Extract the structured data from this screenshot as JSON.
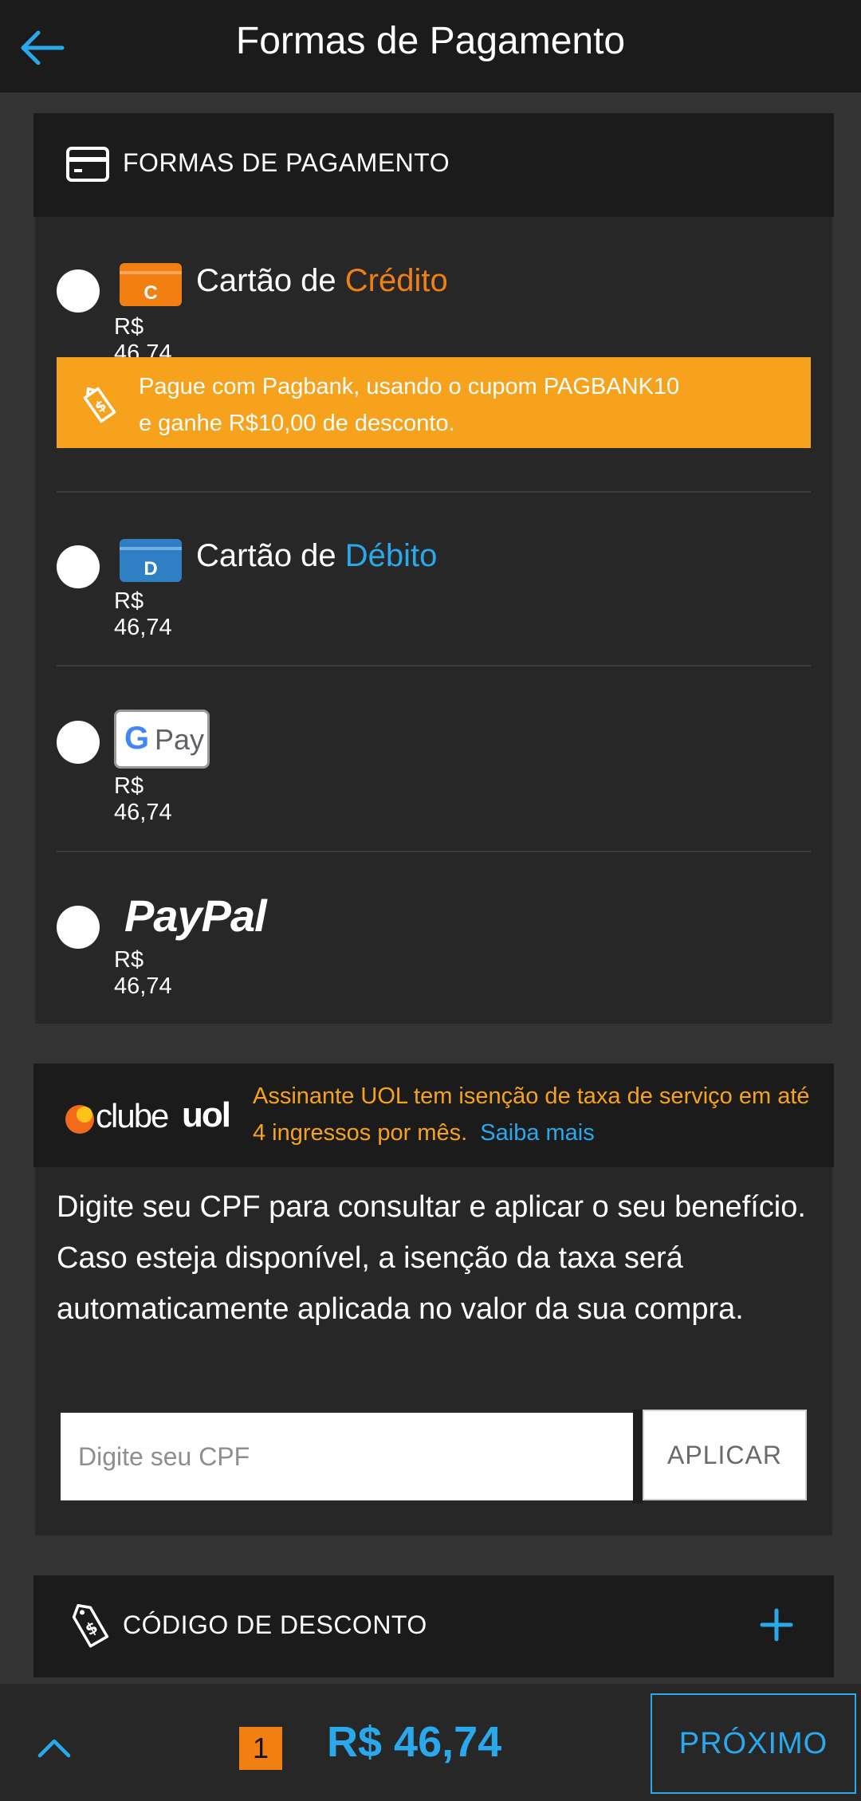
{
  "header": {
    "title": "Formas de Pagamento",
    "back_icon": "arrow-left-icon"
  },
  "payment": {
    "section_label": "FORMAS DE PAGAMENTO",
    "section_icon": "credit-card-icon",
    "methods": [
      {
        "id": "credit",
        "label_prefix": "Cartão de ",
        "label_highlight": "Crédito",
        "highlight_color": "#f17f12",
        "icon_letter": "C",
        "price": "R$ 46,74"
      },
      {
        "id": "debit",
        "label_prefix": "Cartão de ",
        "label_highlight": "Débito",
        "highlight_color": "#2aa8ec",
        "icon_letter": "D",
        "price": "R$ 46,74"
      },
      {
        "id": "gpay",
        "logo_g": "G",
        "logo_pay": "Pay",
        "price": "R$ 46,74"
      },
      {
        "id": "paypal",
        "logo": "PayPal",
        "price": "R$ 46,74"
      }
    ],
    "promo": {
      "line1": "Pague com Pagbank, usando o cupom PAGBANK10",
      "line2": "e ganhe R$10,00 de desconto.",
      "bg_color": "#f7a21c"
    }
  },
  "clube_uol": {
    "logo_text_a": "clube",
    "logo_text_b": "uol",
    "notice": "Assinante UOL tem isenção de taxa de serviço em até 4 ingressos por mês.",
    "link": "Saiba mais",
    "description": "Digite seu CPF para consultar e aplicar o seu benefício. Caso esteja disponível, a isenção da taxa será automaticamente aplicada no valor da sua compra.",
    "cpf_placeholder": "Digite seu CPF",
    "cpf_value": "",
    "apply_label": "APLICAR"
  },
  "discount": {
    "label": "CÓDIGO DE DESCONTO",
    "icon": "price-tag-icon",
    "expand_icon": "plus-icon"
  },
  "footer": {
    "quantity": "1",
    "total": "R$ 46,74",
    "next_label": "PRÓXIMO",
    "toggle_icon": "chevron-up-icon"
  },
  "colors": {
    "accent": "#2aa8ec",
    "orange": "#f17f12",
    "promo": "#f7a21c",
    "bg": "#333333",
    "panel": "#272727",
    "bar": "#1b1b1b"
  }
}
